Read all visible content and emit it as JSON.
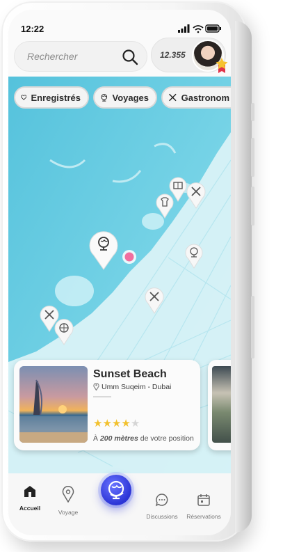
{
  "status_bar": {
    "time": "12:22"
  },
  "search": {
    "placeholder": "Rechercher"
  },
  "user": {
    "points": "12.355"
  },
  "filters": [
    {
      "label": "Enregistrés",
      "icon": "heart-icon"
    },
    {
      "label": "Voyages",
      "icon": "globe-icon"
    },
    {
      "label": "Gastronom",
      "icon": "utensils-icon"
    }
  ],
  "map": {
    "pins": [
      "hotel-icon",
      "utensils-icon",
      "shirt-icon",
      "globe-icon",
      "globe-icon",
      "utensils-icon",
      "utensils-icon",
      "ball-icon"
    ],
    "colors": {
      "water": "#6bd3e4",
      "land": "#d7f1f6",
      "current_location": "#f06f9f"
    }
  },
  "place_card": {
    "title": "Sunset Beach",
    "location": "Umm Suqeim - Dubai",
    "rating": 4,
    "rating_max": 5,
    "distance_prefix": "À",
    "distance_value": "200 mètres",
    "distance_suffix": "de votre position"
  },
  "nav": {
    "home": "Accueil",
    "trip": "Voyage",
    "chat": "Discussions",
    "bookings": "Réservations",
    "accent": "#2b34d6"
  }
}
